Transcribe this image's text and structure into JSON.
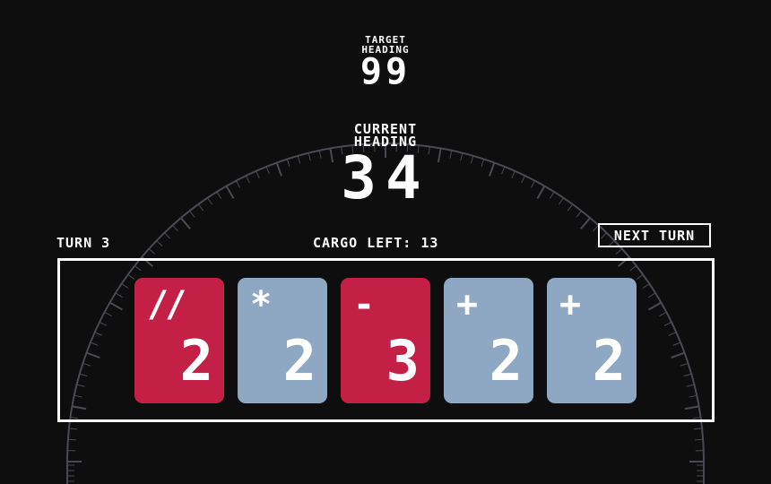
{
  "target": {
    "label_line1": "TARGET",
    "label_line2": "HEADING",
    "value": "99"
  },
  "current": {
    "label_line1": "CURRENT",
    "label_line2": "HEADING",
    "value": "34"
  },
  "turn": {
    "text": "TURN 3"
  },
  "cargo": {
    "text": "CARGO LEFT: 13"
  },
  "next_turn": {
    "label": "NEXT TURN"
  },
  "colors": {
    "red_card": "#c41f45",
    "blue_card": "#8ea8c3",
    "background": "#0e0e0f",
    "dial": "#4a4a52"
  },
  "cards": [
    {
      "op": "//",
      "value": "2",
      "color": "red"
    },
    {
      "op": "*",
      "value": "2",
      "color": "blue"
    },
    {
      "op": "-",
      "value": "3",
      "color": "red"
    },
    {
      "op": "+",
      "value": "2",
      "color": "blue"
    },
    {
      "op": "+",
      "value": "2",
      "color": "blue"
    }
  ]
}
